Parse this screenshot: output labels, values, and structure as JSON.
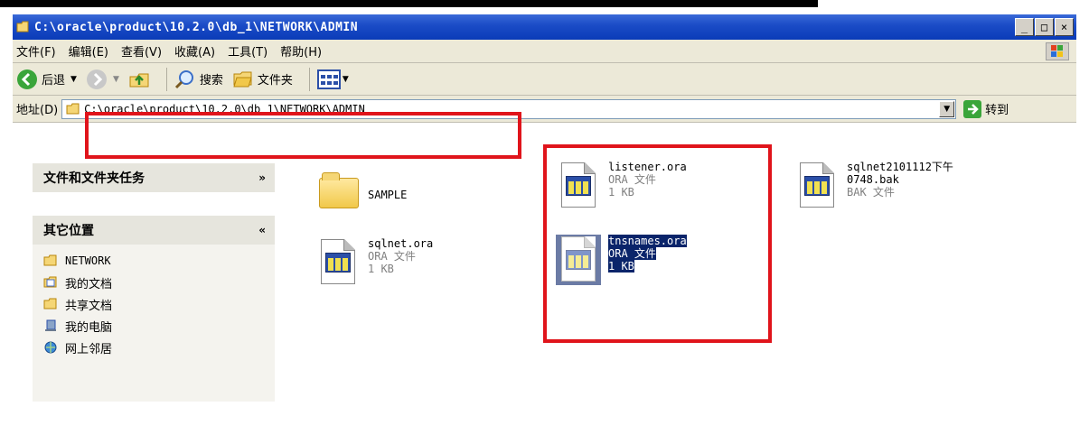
{
  "window": {
    "title": "C:\\oracle\\product\\10.2.0\\db_1\\NETWORK\\ADMIN",
    "buttons": {
      "minimize": "_",
      "maximize": "□",
      "close": "×"
    }
  },
  "menubar": {
    "items": [
      "文件(F)",
      "编辑(E)",
      "查看(V)",
      "收藏(A)",
      "工具(T)",
      "帮助(H)"
    ]
  },
  "toolbar": {
    "back_label": "后退",
    "search_label": "搜索",
    "folders_label": "文件夹"
  },
  "addressbar": {
    "label": "地址(D)",
    "path": "C:\\oracle\\product\\10.2.0\\db_1\\NETWORK\\ADMIN",
    "go_label": "转到"
  },
  "sidebar": {
    "tasks_title": "文件和文件夹任务",
    "other_title": "其它位置",
    "places": [
      "NETWORK",
      "我的文档",
      "共享文档",
      "我的电脑",
      "网上邻居"
    ]
  },
  "files": [
    {
      "name": "SAMPLE",
      "type": "",
      "size": ""
    },
    {
      "name": "sqlnet.ora",
      "type": "ORA 文件",
      "size": "1 KB"
    },
    {
      "name": "listener.ora",
      "type": "ORA 文件",
      "size": "1 KB"
    },
    {
      "name": "tnsnames.ora",
      "type": "ORA 文件",
      "size": "1 KB"
    },
    {
      "name_line1": "sqlnet2101112下午",
      "name_line2": "0748.bak",
      "type": "BAK 文件"
    }
  ]
}
